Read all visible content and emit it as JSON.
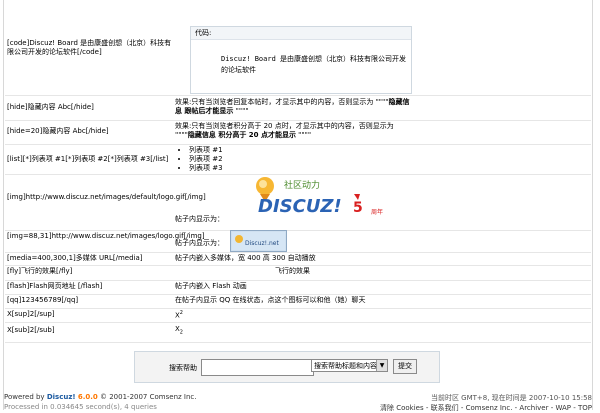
{
  "code_row": {
    "left": "[code]Discuz! Board 是由康盛创想（北京）科技有限公司开发的论坛软件[/code]",
    "box_title": "代码:",
    "box_body": "Discuz! Board 是由康盛创想（北京）科技有限公司开发的论坛软件"
  },
  "hide_row": {
    "left": "[hide]隐藏内容 Abc[/hide]",
    "right_prefix": "效果:只有当浏览者回复本帖时，才显示其中的内容，否则显示为 \"\"\"\"",
    "right_bold": "隐藏信息 跟帖后才能显示",
    "right_suffix": " \"\"\"\""
  },
  "hide20_row": {
    "left": "[hide=20]隐藏内容 Abc[/hide]",
    "right_prefix": "效果:只有当浏览者积分高于 20 点时，才显示其中的内容，否则显示为 \"\"\"\"",
    "right_bold": "隐藏信息 积分高于 20 点才能显示",
    "right_suffix": " \"\"\"\""
  },
  "list_row": {
    "left": "[list][*]列表项 #1[*]列表项 #2[*]列表项 #3[/list]",
    "items": [
      "列表项 #1",
      "列表项 #2",
      "列表项 #3"
    ]
  },
  "img_row": {
    "left": "[img]http://www.discuz.net/images/default/logo.gif[/img]",
    "right": "帖子内显示为：",
    "logo_text": "DISCUZ!",
    "logo_tag": "社区动力",
    "logo_badge": "5",
    "logo_badge_sub": "周年"
  },
  "img_size_row": {
    "left": "[img=88,31]http://www.discuz.net/images/logo.gif[/img]",
    "right": "帖子内显示为：",
    "small_logo": "Discuz!.net"
  },
  "media_row": {
    "left": "[media=400,300,1]多媒体 URL[/media]",
    "right": "帖子内嵌入多媒体，宽 400 高 300 自动播放"
  },
  "fly_row": {
    "left": "[fly]飞行的效果[/fly]",
    "right": "飞行的效果"
  },
  "flash_row": {
    "left": "[flash]Flash网页地址 [/flash]",
    "right": "帖子内嵌入 Flash 动画"
  },
  "qq_row": {
    "left": "[qq]123456789[/qq]",
    "right": "在帖子内显示 QQ 在线状态，点这个图标可以和他（她）聊天"
  },
  "sup_row": {
    "left": "X[sup]2[/sup]",
    "base": "X",
    "exp": "2"
  },
  "sub_row": {
    "left": "X[sub]2[/sub]",
    "base": "X",
    "exp": "2"
  },
  "search": {
    "label": "搜索帮助",
    "input_value": "",
    "select_value": "搜索帮助标题和内容",
    "select_arrow": "▼",
    "button": "提交"
  },
  "footer": {
    "powered": "Powered by",
    "brand": "Discuz!",
    "version": "6.0.0",
    "copyright": "© 2001-2007",
    "company": "Comsenz Inc.",
    "processed": "Processed in 0.034645 second(s), 4 queries",
    "time_info": "当前时区 GMT+8, 现在时间是 2007-10-10 15:58",
    "links": "清除 Cookies - 联系我们 - Comsenz Inc. - Archiver - WAP - TOP"
  },
  "colors": {
    "brand_blue": "#1c5aa0",
    "version_orange": "#ff7700",
    "border": "#cfd8e0"
  }
}
